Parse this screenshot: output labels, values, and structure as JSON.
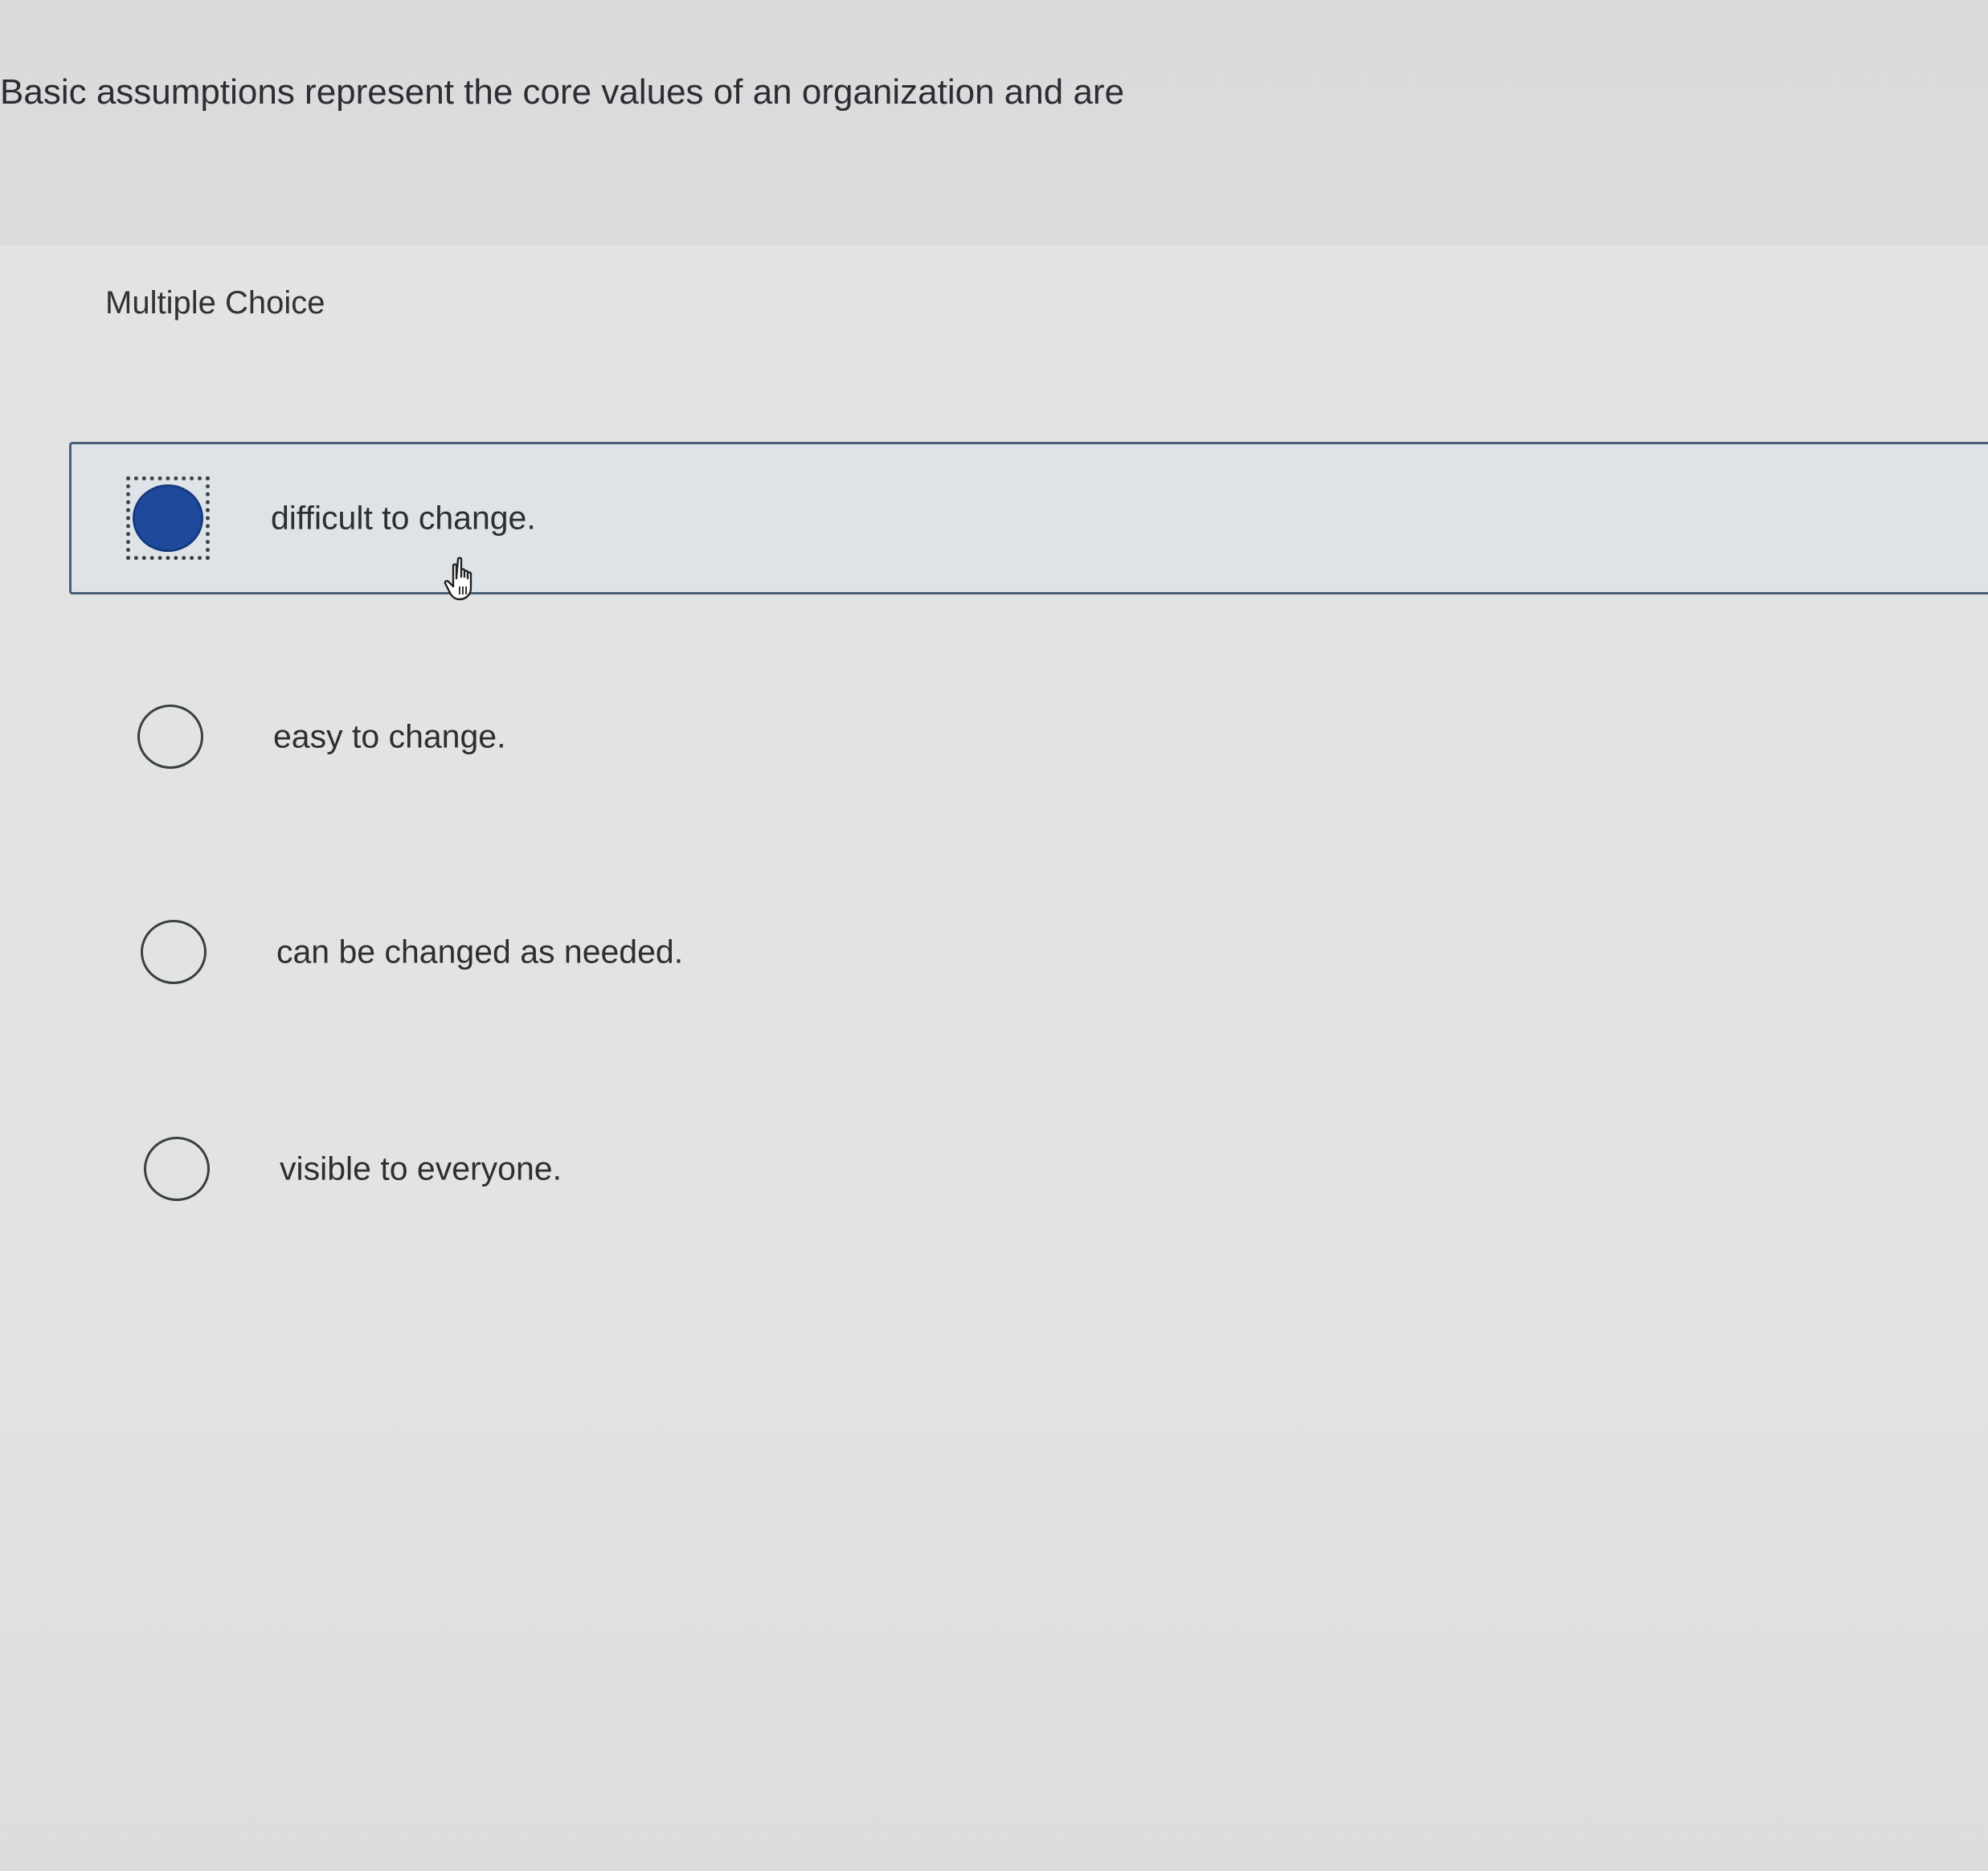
{
  "question": {
    "text": "Basic assumptions represent the core values of an organization and are"
  },
  "multiple_choice": {
    "label": "Multiple Choice",
    "selected_index": 0,
    "options": [
      {
        "text": "difficult to change."
      },
      {
        "text": "easy to change."
      },
      {
        "text": "can be changed as needed."
      },
      {
        "text": "visible to everyone."
      }
    ]
  },
  "colors": {
    "selected_radio": "#1f4a9c",
    "selected_border": "#4c5f7a"
  },
  "cursor_icon": "hand-pointer-icon"
}
